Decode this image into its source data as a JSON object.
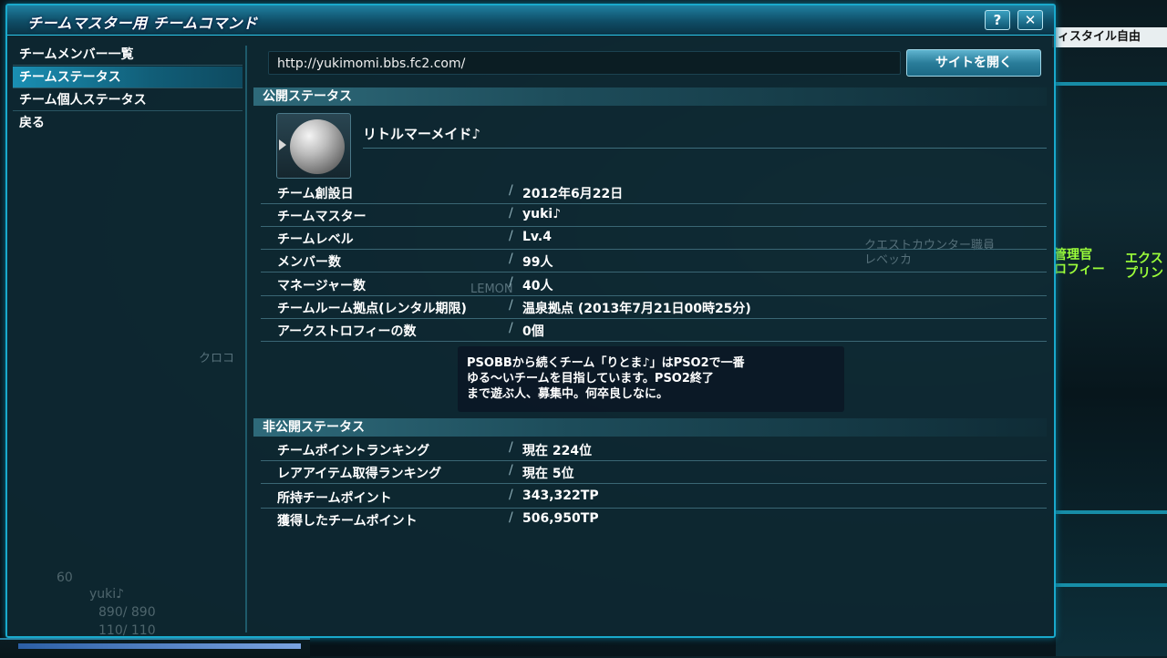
{
  "background": {
    "top_right_text": "ィスタイル自由",
    "npc_left": [
      "管理官",
      "ロフィー"
    ],
    "npc_right": [
      "エクス",
      "プリン"
    ],
    "counter_label": [
      "クエストカウンター職員",
      "レベッカ"
    ],
    "floor_sign": "LEMON",
    "side_label": "クロコ",
    "hud_level": "60",
    "hud_name": "yuki♪",
    "hud_hp": "890/ 890",
    "hud_pp": "110/ 110"
  },
  "window": {
    "title": "チームマスター用 チームコマンド",
    "help_label": "?",
    "close_label": "✕"
  },
  "sidebar": {
    "items": [
      {
        "label": "チームメンバー一覧",
        "active": false
      },
      {
        "label": "チームステータス",
        "active": true
      },
      {
        "label": "チーム個人ステータス",
        "active": false
      },
      {
        "label": "戻る",
        "active": false
      }
    ]
  },
  "site": {
    "url": "http://yukimomi.bbs.fc2.com/",
    "open_button": "サイトを開く"
  },
  "public": {
    "header": "公開ステータス",
    "team_name": "リトルマーメイド♪",
    "emblem_icon": "team-emblem",
    "rows": [
      {
        "label": "チーム創設日",
        "value": "2012年6月22日"
      },
      {
        "label": "チームマスター",
        "value": "yuki♪"
      },
      {
        "label": "チームレベル",
        "value": "Lv.4"
      },
      {
        "label": "メンバー数",
        "value": "99人"
      },
      {
        "label": "マネージャー数",
        "value": "40人"
      },
      {
        "label": "チームルーム拠点(レンタル期限)",
        "value": "温泉拠点 (2013年7月21日00時25分)"
      },
      {
        "label": "アークストロフィーの数",
        "value": "0個"
      }
    ],
    "comment_lines": [
      "PSOBBから続くチーム「りとま♪」はPSO2で一番",
      "ゆる～いチームを目指しています。PSO2終了",
      "まで遊ぶ人、募集中。何卒良しなに。"
    ]
  },
  "private": {
    "header": "非公開ステータス",
    "rows": [
      {
        "label": "チームポイントランキング",
        "value": "現在 224位"
      },
      {
        "label": "レアアイテム取得ランキング",
        "value": "現在 5位"
      },
      {
        "label": "所持チームポイント",
        "value": "343,322TP"
      },
      {
        "label": "獲得したチームポイント",
        "value": "506,950TP"
      }
    ]
  },
  "colors": {
    "accent": "#19a9cc",
    "active_menu": "#1a8fb3",
    "npc_text": "#9cff3a"
  }
}
